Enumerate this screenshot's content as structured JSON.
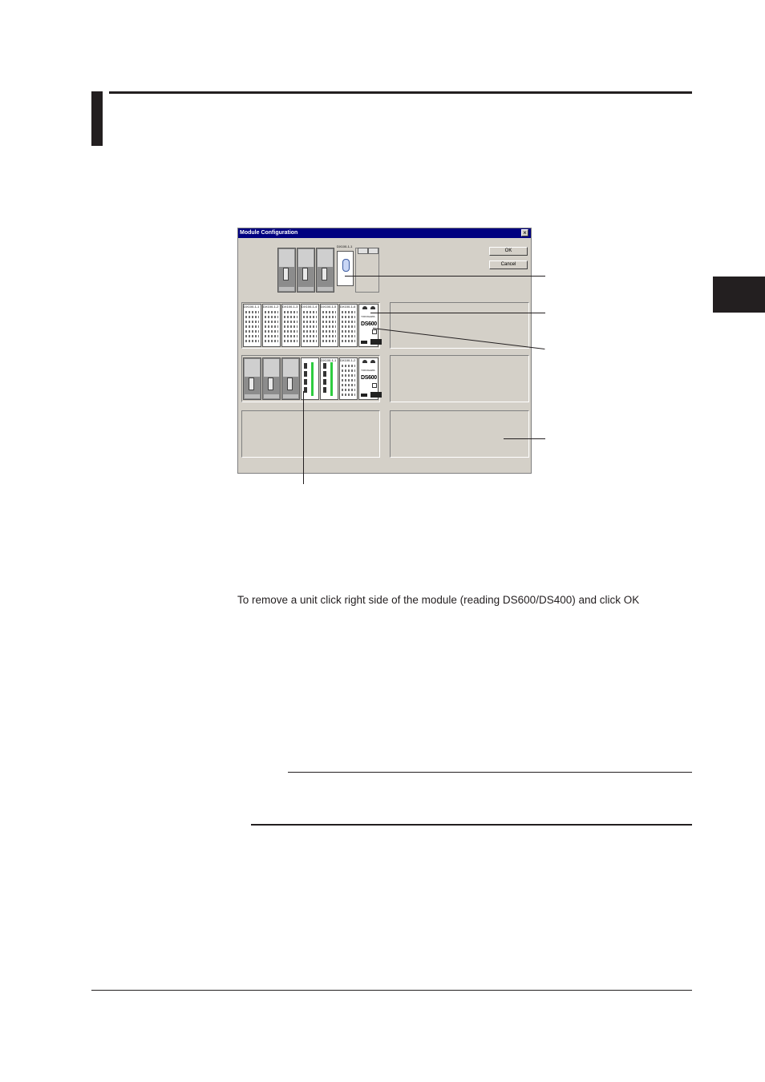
{
  "dialog": {
    "title": "Module Configuration",
    "close_glyph": "×",
    "ok_label": "OK",
    "cancel_label": "Cancel",
    "top_unit_label": "DX100-1-1",
    "row2_module_labels": [
      "DX100-1-1",
      "DX100-1-2",
      "DX100-1-3",
      "DX100-1-4",
      "DX100-1-5",
      "DX100-1-6"
    ],
    "row3_module_labels": [
      "DX100-1-1",
      "DX100-1-2"
    ],
    "ds_logo": "DS600"
  },
  "page": {
    "instruction": "To remove a unit click right side of the module (reading DS600/DS400) and click OK"
  }
}
